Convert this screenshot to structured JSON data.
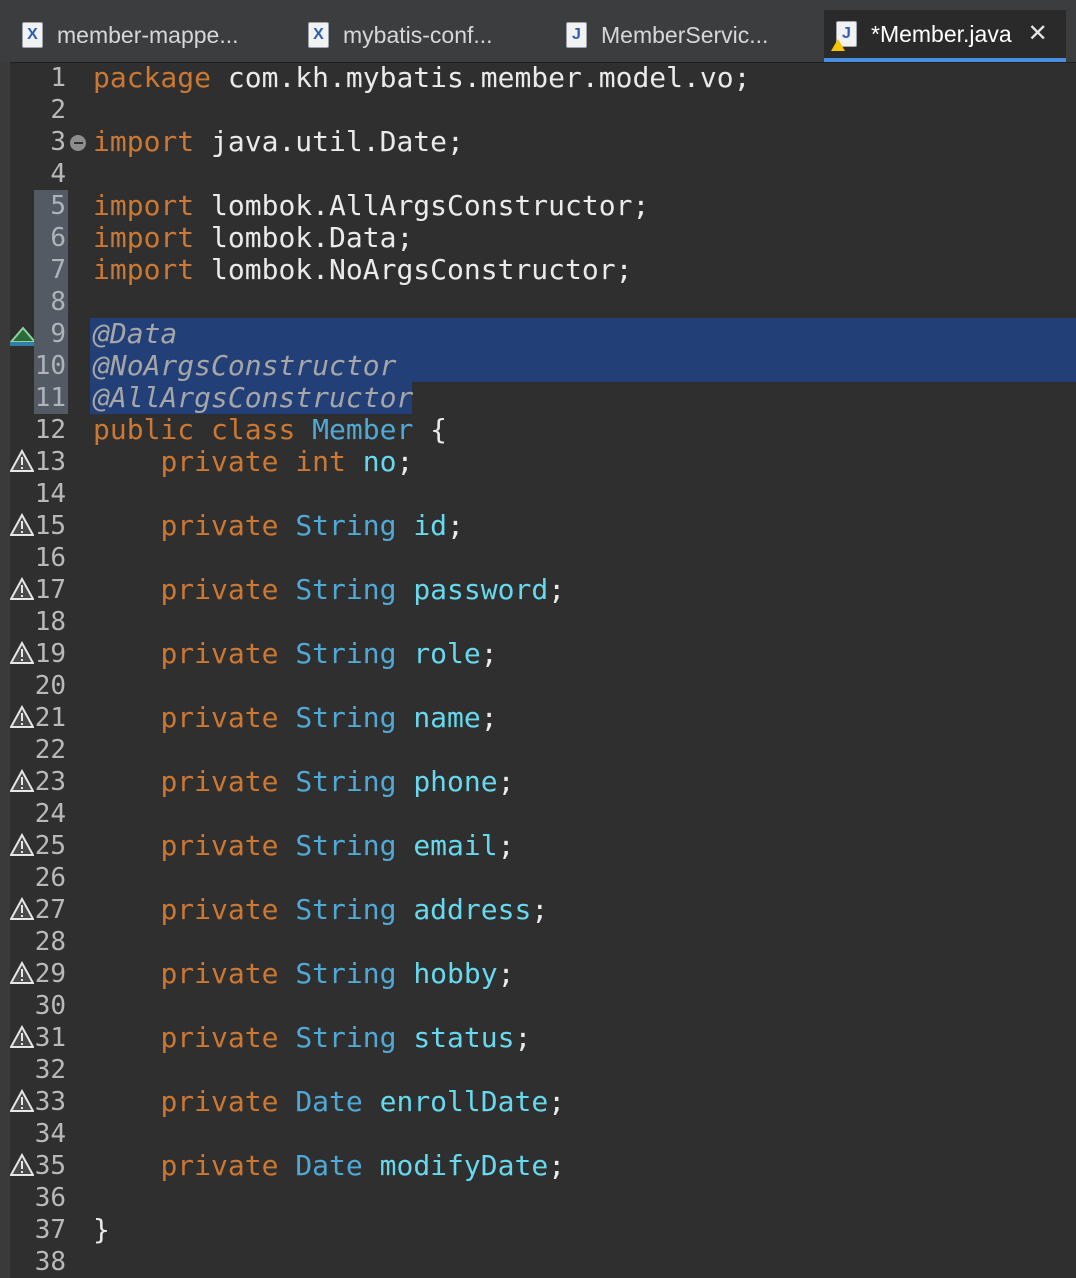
{
  "tabs": [
    {
      "label": "member-mappe...",
      "icon": "xml-file-icon",
      "active": false
    },
    {
      "label": "mybatis-conf...",
      "icon": "xml-file-icon",
      "active": false
    },
    {
      "label": "MemberServic...",
      "icon": "java-file-icon",
      "active": false
    },
    {
      "label": "*Member.java",
      "icon": "java-file-warning-icon",
      "active": true
    }
  ],
  "editor": {
    "line_numbers": [
      "1",
      "2",
      "3",
      "4",
      "5",
      "6",
      "7",
      "8",
      "9",
      "10",
      "11",
      "12",
      "13",
      "14",
      "15",
      "16",
      "17",
      "18",
      "19",
      "20",
      "21",
      "22",
      "23",
      "24",
      "25",
      "26",
      "27",
      "28",
      "29",
      "30",
      "31",
      "32",
      "33",
      "34",
      "35",
      "36",
      "37",
      "38"
    ],
    "package_kw": "package",
    "package_name": " com.kh.mybatis.member.model.vo;",
    "import_kw": "import",
    "imports": [
      " java.util.Date;",
      " lombok.AllArgsConstructor;",
      " lombok.Data;",
      " lombok.NoArgsConstructor;"
    ],
    "annotations": [
      "@Data",
      "@NoArgsConstructor",
      "@AllArgsConstructor"
    ],
    "class_decl": {
      "kw1": "public",
      "kw2": "class",
      "name": "Member",
      "brace": " {"
    },
    "fields": [
      {
        "mod": "private",
        "type": "int",
        "name": "no"
      },
      {
        "mod": "private",
        "type": "String",
        "name": "id"
      },
      {
        "mod": "private",
        "type": "String",
        "name": "password"
      },
      {
        "mod": "private",
        "type": "String",
        "name": "role"
      },
      {
        "mod": "private",
        "type": "String",
        "name": "name"
      },
      {
        "mod": "private",
        "type": "String",
        "name": "phone"
      },
      {
        "mod": "private",
        "type": "String",
        "name": "email"
      },
      {
        "mod": "private",
        "type": "String",
        "name": "address"
      },
      {
        "mod": "private",
        "type": "String",
        "name": "hobby"
      },
      {
        "mod": "private",
        "type": "String",
        "name": "status"
      },
      {
        "mod": "private",
        "type": "Date",
        "name": "enrollDate"
      },
      {
        "mod": "private",
        "type": "Date",
        "name": "modifyDate"
      }
    ],
    "semicolon": ";",
    "closing_brace": "}",
    "selected_lines": [
      "5",
      "6",
      "7",
      "8",
      "9",
      "10",
      "11"
    ],
    "colors": {
      "keyword": "#cc7832",
      "type": "#4fa9d6",
      "field": "#66d9ef",
      "selection": "#223f78"
    }
  }
}
